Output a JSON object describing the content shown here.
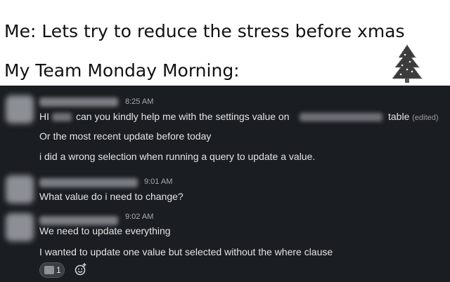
{
  "caption": {
    "line1": "Me: Lets try to reduce the stress before xmas",
    "line2": "My Team Monday Morning:"
  },
  "messages": [
    {
      "time": "8:25 AM",
      "line1_a": "HI",
      "line1_b": "can you kindly help me with the settings value on",
      "line1_c": "table",
      "edited": "(edited)",
      "line2": "Or the most recent update before today",
      "line3": "i did a wrong selection when running a query to update a value."
    },
    {
      "time": "9:01 AM",
      "line1": "What value do i need to change?"
    },
    {
      "time": "9:02 AM",
      "line1": "We need to update everything",
      "line2": "I wanted to update one value but selected without the where clause"
    }
  ],
  "reaction": {
    "count": "1",
    "icon": "emoji-reaction-icon"
  },
  "add_reaction_icon": "add-reaction-icon",
  "colors": {
    "chat_bg": "#1a1d21",
    "text": "#d1d2d3"
  }
}
